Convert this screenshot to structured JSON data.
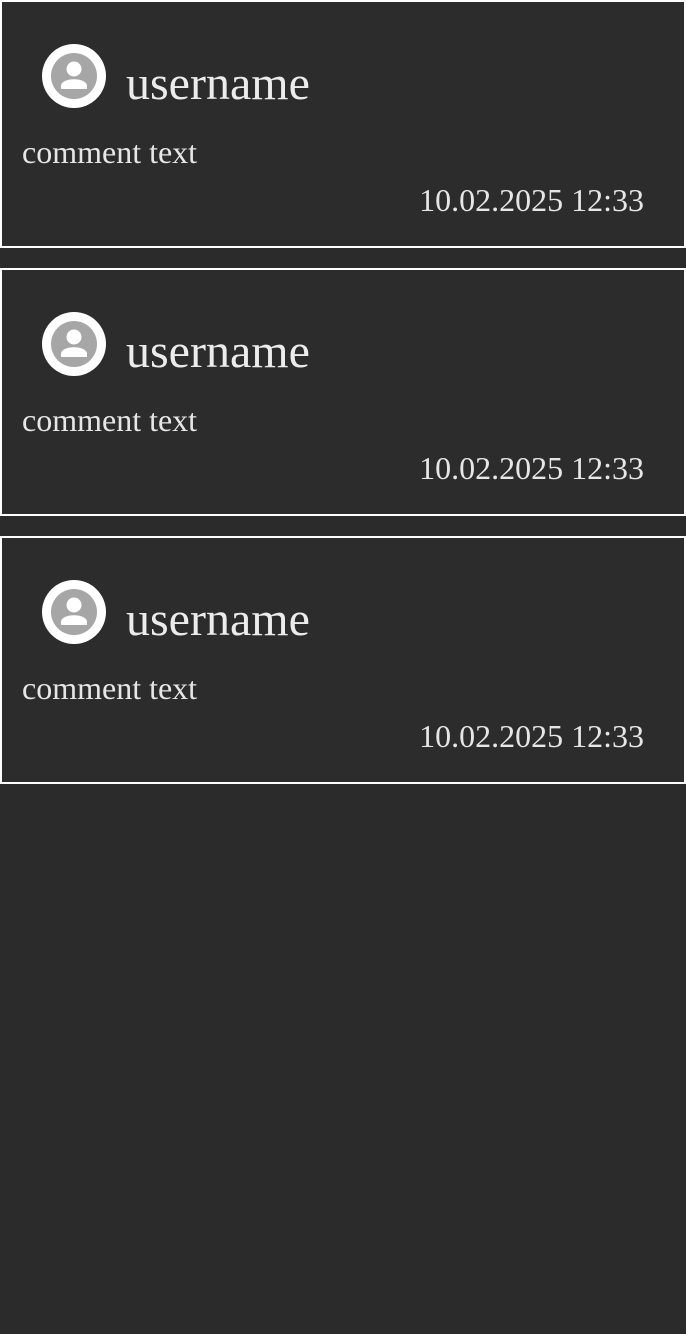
{
  "comments": [
    {
      "avatar_icon": "user-avatar-icon",
      "username": "username",
      "text": "comment text",
      "timestamp": "10.02.2025 12:33"
    },
    {
      "avatar_icon": "user-avatar-icon",
      "username": "username",
      "text": "comment text",
      "timestamp": "10.02.2025 12:33"
    },
    {
      "avatar_icon": "user-avatar-icon",
      "username": "username",
      "text": "comment text",
      "timestamp": "10.02.2025 12:33"
    }
  ],
  "colors": {
    "background": "#2b2b2b",
    "card_border": "#ffffff",
    "text": "#e6e6e6",
    "avatar_ring": "#ffffff",
    "avatar_fill": "#a6a6a6"
  }
}
